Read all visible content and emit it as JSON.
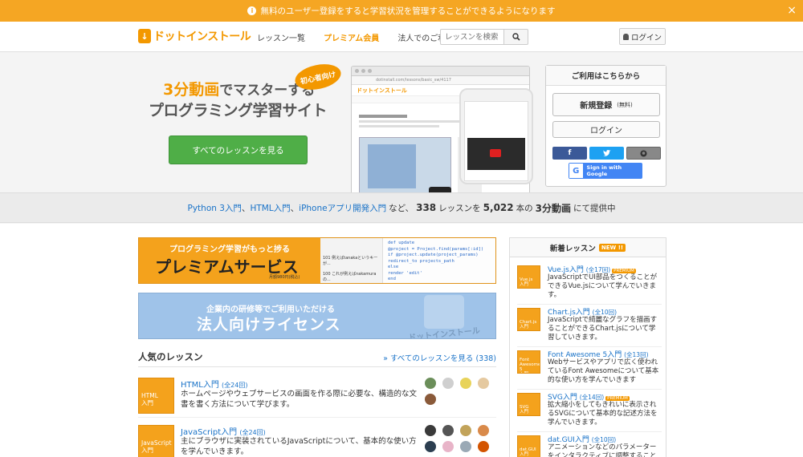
{
  "notice": {
    "text": "無料のユーザー登録をすると学習状況を管理することができるようになります",
    "close": "×"
  },
  "header": {
    "logo": "ドットインストール",
    "nav": [
      "レッスン一覧",
      "プレミアム会員",
      "法人でのご利用"
    ],
    "search_placeholder": "レッスンを検索",
    "login": "ログイン"
  },
  "hero": {
    "line1_accent": "3分動画",
    "line1_rest": "でマスターする",
    "line2": "プログラミング学習サイト",
    "badge": "初心者向け",
    "button": "すべてのレッスンを見る"
  },
  "login_box": {
    "title": "ご利用はこちらから",
    "register": "新規登録",
    "register_note": "(無料)",
    "login": "ログイン",
    "google": "Sign in with Google"
  },
  "stats": {
    "links": [
      "Python 3入門",
      "HTML入門",
      "iPhoneアプリ開発入門"
    ],
    "sep": "、",
    "mid": "など、",
    "lessons_count": "338",
    "lessons_unit": "レッスンを",
    "videos_count": "5,022",
    "videos_unit": "本の",
    "videos_label": "3分動画",
    "suffix": "にて提供中"
  },
  "banners": {
    "premium_small": "プログラミング学習がもっと捗る",
    "premium_big": "プレミアムサービス",
    "premium_note": "月額980円(税込)",
    "chat1": "101 例えばtanakaというキーが...",
    "chat2": "100 これが例えばnakamuraの...",
    "code": [
      "def update",
      "  @project = Project.find(params[:id])",
      "  if @project.update(project_params)",
      "    redirect_to projects_path",
      "  else",
      "    render 'edit'",
      "  end"
    ],
    "corp_small": "企業内の研修等でご利用いただける",
    "corp_big": "法人向けライセンス",
    "corp_mark": "ドットインストール"
  },
  "popular": {
    "title": "人気のレッスン",
    "all_link": "» すべてのレッスンを見る (338)",
    "items": [
      {
        "thumb": "HTML\n入門",
        "title": "HTML入門",
        "count": "(全24回)",
        "desc": "ホームページやウェブサービスの画面を作る際に必要な、構造的な文書を書く方法について学びます。"
      },
      {
        "thumb": "JavaScript\n入門",
        "title": "JavaScript入門",
        "count": "(全24回)",
        "desc": "主にブラウザに実装されているJavaScriptについて、基本的な使い方を学んでいきます。"
      }
    ]
  },
  "new_lessons": {
    "title": "新着レッスン",
    "badge": "NEW !!",
    "items": [
      {
        "thumb": "Vue.js\n入門",
        "title": "Vue.js入門",
        "count": "(全17回)",
        "premium": "PREMIUM",
        "desc": "JavaScriptでUI部品をつくることができるVue.jsについて学んでいきます。"
      },
      {
        "thumb": "Chart.js\n入門",
        "title": "Chart.js入門",
        "count": "(全10回)",
        "premium": "",
        "desc": "JavaScriptで綺麗なグラフを描画することができるChart.jsについて学習していきます。"
      },
      {
        "thumb": "Font\nAwesome 5\n入門",
        "title": "Font Awesome 5入門",
        "count": "(全13回)",
        "premium": "",
        "desc": "Webサービスやアプリで広く使われているFont Awesomeについて基本的な使い方を学んでいきます"
      },
      {
        "thumb": "SVG\n入門",
        "title": "SVG入門",
        "count": "(全14回)",
        "premium": "PREMIUM",
        "desc": "拡大縮小をしてもきれいに表示されるSVGについて基本的な記述方法を学んでいきます。"
      },
      {
        "thumb": "dat.GUI\n入門",
        "title": "dat.GUI入門",
        "count": "(全10回)",
        "premium": "",
        "desc": "アニメーションなどのパラメーターをインタラクティブに調整することができるdat.GUIについて学んでいきます。"
      }
    ]
  },
  "colors": {
    "brand": "#f39800",
    "link": "#1a73c8",
    "hero_button": "#4fae47"
  }
}
